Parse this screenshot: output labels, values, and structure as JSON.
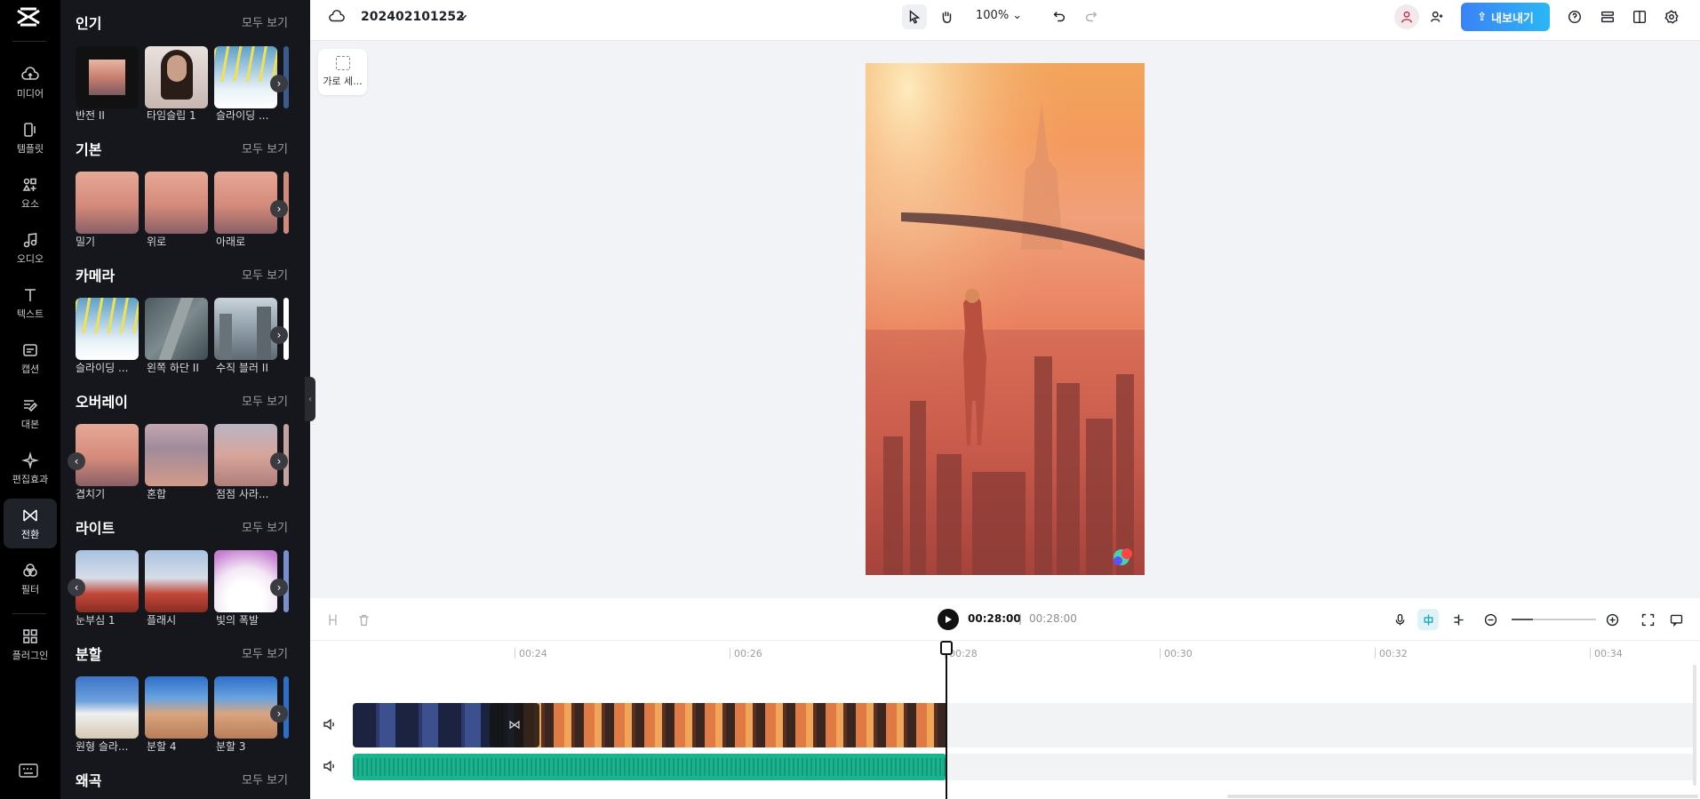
{
  "rail": {
    "items": [
      {
        "label": "미디어",
        "icon": "cloud-upload-icon"
      },
      {
        "label": "템플릿",
        "icon": "template-icon"
      },
      {
        "label": "요소",
        "icon": "elements-icon"
      },
      {
        "label": "오디오",
        "icon": "music-note-icon"
      },
      {
        "label": "텍스트",
        "icon": "text-icon"
      },
      {
        "label": "캡션",
        "icon": "caption-icon"
      },
      {
        "label": "대본",
        "icon": "script-icon"
      },
      {
        "label": "편집효과",
        "icon": "sparkle-icon"
      },
      {
        "label": "전환",
        "icon": "transition-icon",
        "active": true
      },
      {
        "label": "필터",
        "icon": "filter-icon"
      },
      {
        "label": "플러그인",
        "icon": "plugin-grid-icon"
      }
    ]
  },
  "panel": {
    "see_all": "모두 보기",
    "sections": [
      {
        "title": "인기",
        "items": [
          "반전 II",
          "타임슬립 1",
          "슬라이딩 ..."
        ]
      },
      {
        "title": "기본",
        "items": [
          "밀기",
          "위로",
          "아래로"
        ]
      },
      {
        "title": "카메라",
        "items": [
          "슬라이딩 ...",
          "왼쪽 하단 II",
          "수직 블러 II"
        ]
      },
      {
        "title": "오버레이",
        "items": [
          "겹치기",
          "혼합",
          "점점 사라..."
        ]
      },
      {
        "title": "라이트",
        "items": [
          "눈부심 1",
          "플래시",
          "빛의 폭발"
        ]
      },
      {
        "title": "분할",
        "items": [
          "원형 슬라...",
          "분할 4",
          "분할 3"
        ]
      },
      {
        "title": "왜곡",
        "items": []
      }
    ]
  },
  "topbar": {
    "project_name": "202402101252",
    "zoom": "100%",
    "export_label": "내보내기"
  },
  "canvas": {
    "ratio_label": "가로 세..."
  },
  "timeline": {
    "current_time": "00:28:00",
    "separator": "|",
    "total_time": "00:28:00",
    "ticks": [
      "00:24",
      "00:26",
      "00:28",
      "00:30",
      "00:32",
      "00:34"
    ]
  },
  "colors": {
    "export_start": "#3b82f6",
    "export_end": "#2bb7f5",
    "audio_clip": "#19b48e",
    "rail_bg": "#000000",
    "panel_bg": "#16171c"
  }
}
